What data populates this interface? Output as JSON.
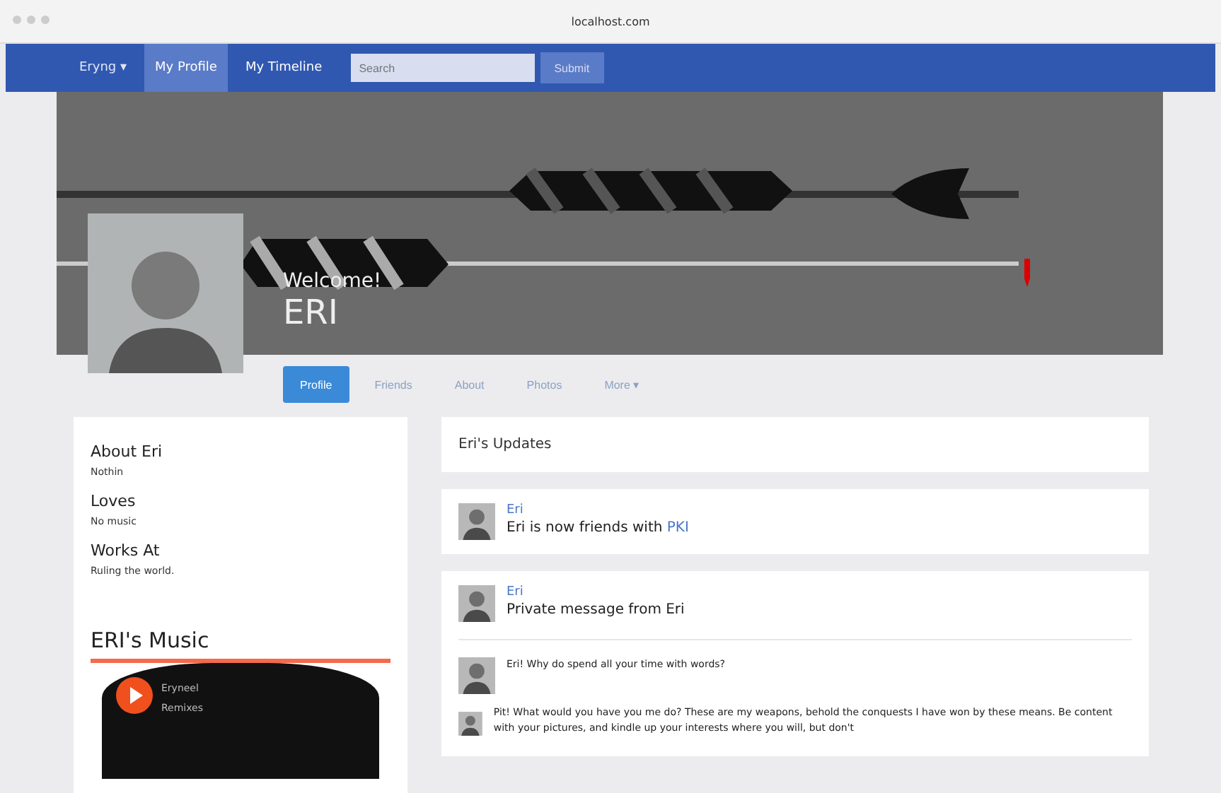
{
  "browser": {
    "url": "localhost.com"
  },
  "navbar": {
    "brand": "Eryng ▾",
    "links": [
      {
        "label": "My Profile",
        "selected": true
      },
      {
        "label": "My Timeline",
        "selected": false
      }
    ],
    "search": {
      "placeholder": "Search"
    },
    "submit": "Submit"
  },
  "header": {
    "welcome": "Welcome!",
    "name": "ERI"
  },
  "tabs": [
    {
      "label": "Profile",
      "selected": true
    },
    {
      "label": "Friends",
      "selected": false
    },
    {
      "label": "About",
      "selected": false
    },
    {
      "label": "Photos",
      "selected": false
    },
    {
      "label": "More ▾",
      "selected": false
    }
  ],
  "about": [
    {
      "kind": "heading",
      "text": "About Eri"
    },
    {
      "kind": "value",
      "text": "Nothin"
    },
    {
      "kind": "heading",
      "text": "Loves"
    },
    {
      "kind": "value",
      "text": "No music"
    },
    {
      "kind": "heading",
      "text": "Works At"
    },
    {
      "kind": "value",
      "text": "Ruling the world."
    }
  ],
  "music": {
    "title": "ERI's Music",
    "track_artist": "Eryneel",
    "track_title": "Remixes"
  },
  "updates": {
    "title": "Eri's Updates",
    "items": [
      {
        "kind": "friend",
        "author": "Eri",
        "text": "Eri is now friends with ",
        "link": "PKI"
      },
      {
        "kind": "message",
        "author": "Eri",
        "text": "Private message from Eri",
        "messages": [
          "Eri! Why do spend all your time with words?",
          "Pit! What would you have you me do? These are my weapons, behold the conquests I have won by these means. Be content with your pictures, and kindle up your interests where you will, but don't"
        ]
      }
    ]
  }
}
